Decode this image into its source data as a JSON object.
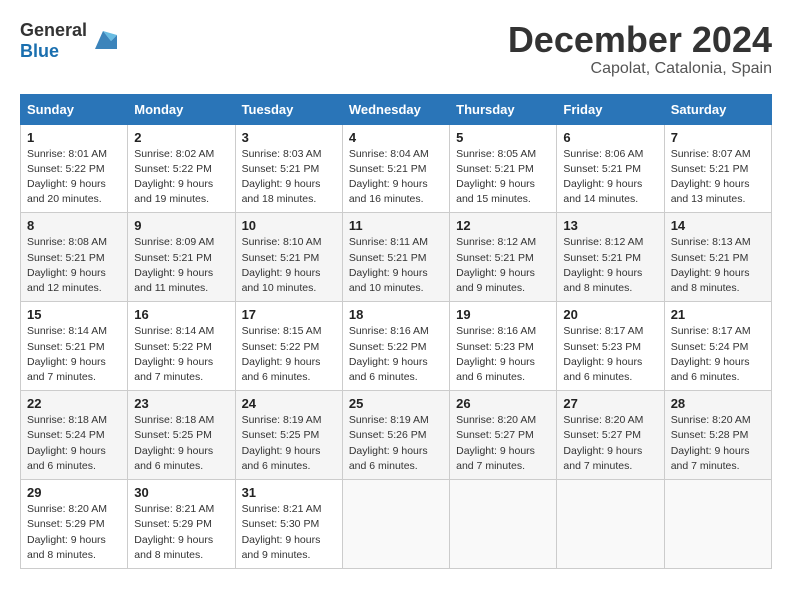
{
  "header": {
    "logo_general": "General",
    "logo_blue": "Blue",
    "month_title": "December 2024",
    "location": "Capolat, Catalonia, Spain"
  },
  "calendar": {
    "days_of_week": [
      "Sunday",
      "Monday",
      "Tuesday",
      "Wednesday",
      "Thursday",
      "Friday",
      "Saturday"
    ],
    "weeks": [
      [
        {
          "day": "1",
          "sunrise": "8:01 AM",
          "sunset": "5:22 PM",
          "daylight": "9 hours and 20 minutes."
        },
        {
          "day": "2",
          "sunrise": "8:02 AM",
          "sunset": "5:22 PM",
          "daylight": "9 hours and 19 minutes."
        },
        {
          "day": "3",
          "sunrise": "8:03 AM",
          "sunset": "5:21 PM",
          "daylight": "9 hours and 18 minutes."
        },
        {
          "day": "4",
          "sunrise": "8:04 AM",
          "sunset": "5:21 PM",
          "daylight": "9 hours and 16 minutes."
        },
        {
          "day": "5",
          "sunrise": "8:05 AM",
          "sunset": "5:21 PM",
          "daylight": "9 hours and 15 minutes."
        },
        {
          "day": "6",
          "sunrise": "8:06 AM",
          "sunset": "5:21 PM",
          "daylight": "9 hours and 14 minutes."
        },
        {
          "day": "7",
          "sunrise": "8:07 AM",
          "sunset": "5:21 PM",
          "daylight": "9 hours and 13 minutes."
        }
      ],
      [
        {
          "day": "8",
          "sunrise": "8:08 AM",
          "sunset": "5:21 PM",
          "daylight": "9 hours and 12 minutes."
        },
        {
          "day": "9",
          "sunrise": "8:09 AM",
          "sunset": "5:21 PM",
          "daylight": "9 hours and 11 minutes."
        },
        {
          "day": "10",
          "sunrise": "8:10 AM",
          "sunset": "5:21 PM",
          "daylight": "9 hours and 10 minutes."
        },
        {
          "day": "11",
          "sunrise": "8:11 AM",
          "sunset": "5:21 PM",
          "daylight": "9 hours and 10 minutes."
        },
        {
          "day": "12",
          "sunrise": "8:12 AM",
          "sunset": "5:21 PM",
          "daylight": "9 hours and 9 minutes."
        },
        {
          "day": "13",
          "sunrise": "8:12 AM",
          "sunset": "5:21 PM",
          "daylight": "9 hours and 8 minutes."
        },
        {
          "day": "14",
          "sunrise": "8:13 AM",
          "sunset": "5:21 PM",
          "daylight": "9 hours and 8 minutes."
        }
      ],
      [
        {
          "day": "15",
          "sunrise": "8:14 AM",
          "sunset": "5:21 PM",
          "daylight": "9 hours and 7 minutes."
        },
        {
          "day": "16",
          "sunrise": "8:14 AM",
          "sunset": "5:22 PM",
          "daylight": "9 hours and 7 minutes."
        },
        {
          "day": "17",
          "sunrise": "8:15 AM",
          "sunset": "5:22 PM",
          "daylight": "9 hours and 6 minutes."
        },
        {
          "day": "18",
          "sunrise": "8:16 AM",
          "sunset": "5:22 PM",
          "daylight": "9 hours and 6 minutes."
        },
        {
          "day": "19",
          "sunrise": "8:16 AM",
          "sunset": "5:23 PM",
          "daylight": "9 hours and 6 minutes."
        },
        {
          "day": "20",
          "sunrise": "8:17 AM",
          "sunset": "5:23 PM",
          "daylight": "9 hours and 6 minutes."
        },
        {
          "day": "21",
          "sunrise": "8:17 AM",
          "sunset": "5:24 PM",
          "daylight": "9 hours and 6 minutes."
        }
      ],
      [
        {
          "day": "22",
          "sunrise": "8:18 AM",
          "sunset": "5:24 PM",
          "daylight": "9 hours and 6 minutes."
        },
        {
          "day": "23",
          "sunrise": "8:18 AM",
          "sunset": "5:25 PM",
          "daylight": "9 hours and 6 minutes."
        },
        {
          "day": "24",
          "sunrise": "8:19 AM",
          "sunset": "5:25 PM",
          "daylight": "9 hours and 6 minutes."
        },
        {
          "day": "25",
          "sunrise": "8:19 AM",
          "sunset": "5:26 PM",
          "daylight": "9 hours and 6 minutes."
        },
        {
          "day": "26",
          "sunrise": "8:20 AM",
          "sunset": "5:27 PM",
          "daylight": "9 hours and 7 minutes."
        },
        {
          "day": "27",
          "sunrise": "8:20 AM",
          "sunset": "5:27 PM",
          "daylight": "9 hours and 7 minutes."
        },
        {
          "day": "28",
          "sunrise": "8:20 AM",
          "sunset": "5:28 PM",
          "daylight": "9 hours and 7 minutes."
        }
      ],
      [
        {
          "day": "29",
          "sunrise": "8:20 AM",
          "sunset": "5:29 PM",
          "daylight": "9 hours and 8 minutes."
        },
        {
          "day": "30",
          "sunrise": "8:21 AM",
          "sunset": "5:29 PM",
          "daylight": "9 hours and 8 minutes."
        },
        {
          "day": "31",
          "sunrise": "8:21 AM",
          "sunset": "5:30 PM",
          "daylight": "9 hours and 9 minutes."
        },
        null,
        null,
        null,
        null
      ]
    ]
  }
}
